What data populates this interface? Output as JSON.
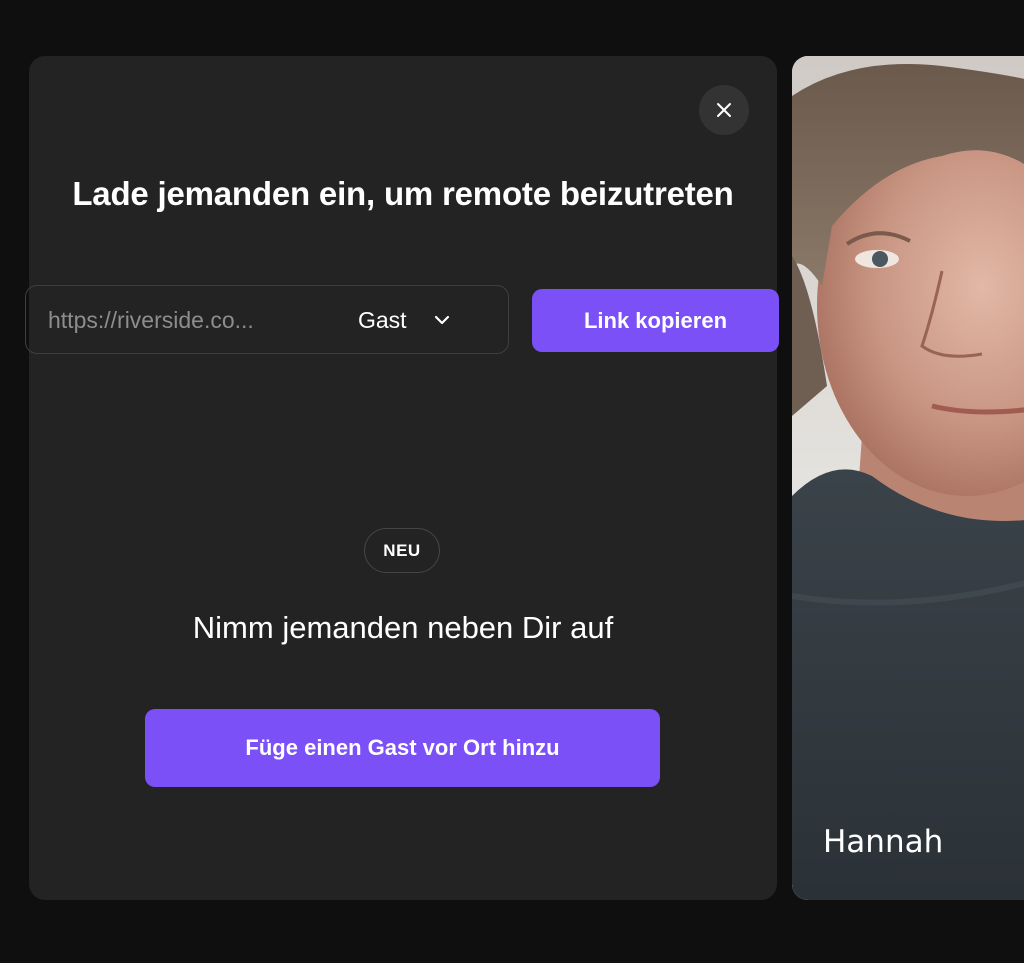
{
  "invite": {
    "title": "Lade jemanden ein, um remote beizutreten",
    "link_placeholder": "https://riverside.co...",
    "role_selected": "Gast",
    "copy_button_label": "Link kopieren",
    "close_icon": "close-icon",
    "chevron_icon": "chevron-down-icon"
  },
  "local_guest": {
    "badge": "NEU",
    "title": "Nimm jemanden neben Dir auf",
    "button_label": "Füge einen Gast vor Ort hinzu"
  },
  "participant": {
    "name": "Hannah"
  },
  "colors": {
    "background": "#0f0f0f",
    "panel": "#232323",
    "accent": "#7b50f6"
  }
}
